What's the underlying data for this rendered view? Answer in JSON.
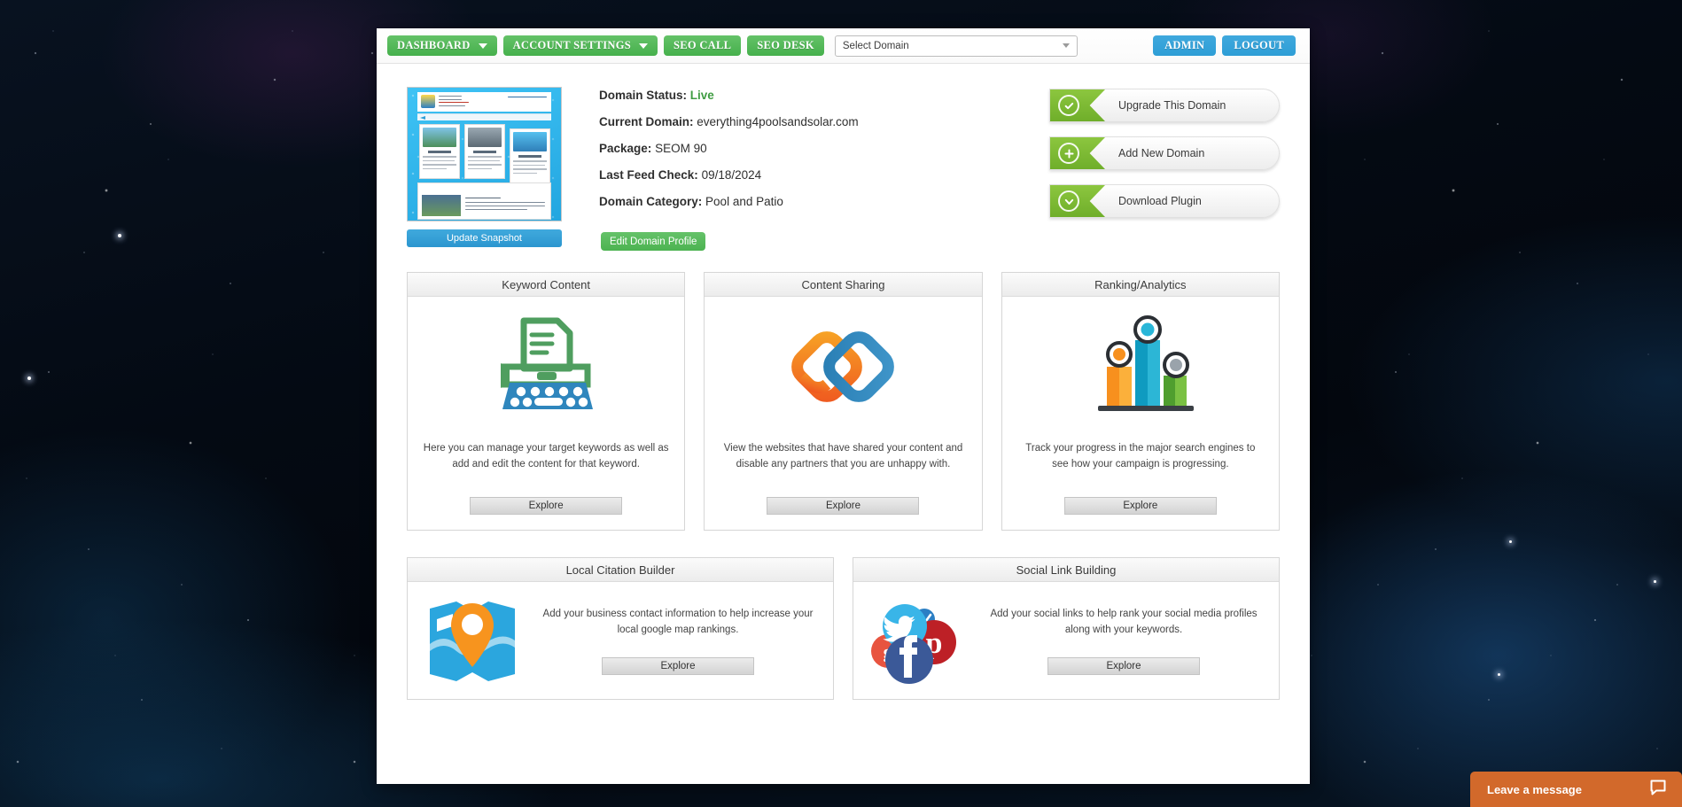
{
  "nav": {
    "buttons": [
      {
        "label": "DASHBOARD",
        "caret": true
      },
      {
        "label": "ACCOUNT SETTINGS",
        "caret": true
      },
      {
        "label": "SEO CALL",
        "caret": false
      },
      {
        "label": "SEO DESK",
        "caret": false
      }
    ],
    "domain_select": {
      "value": "Select Domain",
      "icon": "chevron-down-icon"
    },
    "admin_label": "ADMIN",
    "logout_label": "LOGOUT"
  },
  "summary": {
    "update_snapshot_label": "Update Snapshot",
    "edit_profile_label": "Edit Domain Profile",
    "details": [
      {
        "label": "Domain Status:",
        "value": "Live",
        "highlight": true
      },
      {
        "label": "Current Domain:",
        "value": "everything4poolsandsolar.com",
        "highlight": false
      },
      {
        "label": "Package:",
        "value": "SEOM 90",
        "highlight": false
      },
      {
        "label": "Last Feed Check:",
        "value": "09/18/2024",
        "highlight": false
      },
      {
        "label": "Domain Category:",
        "value": "Pool and Patio",
        "highlight": false
      }
    ]
  },
  "actions": [
    {
      "label": "Upgrade This Domain",
      "icon": "check-circle-icon"
    },
    {
      "label": "Add New Domain",
      "icon": "plus-circle-icon"
    },
    {
      "label": "Download Plugin",
      "icon": "download-circle-icon"
    }
  ],
  "cards_top": [
    {
      "title": "Keyword Content",
      "icon": "typewriter-icon",
      "description": "Here you can manage your target keywords as well as add and edit the content for that keyword.",
      "button": "Explore"
    },
    {
      "title": "Content Sharing",
      "icon": "interlocking-links-icon",
      "description": "View the websites that have shared your content and disable any partners that you are unhappy with.",
      "button": "Explore"
    },
    {
      "title": "Ranking/Analytics",
      "icon": "bar-chart-icon",
      "description": "Track your progress in the major search engines to see how your campaign is progressing.",
      "button": "Explore"
    }
  ],
  "cards_bottom": [
    {
      "title": "Local Citation Builder",
      "icon": "map-pin-icon",
      "description": "Add your business contact information to help increase your local google map rankings.",
      "button": "Explore"
    },
    {
      "title": "Social Link Building",
      "icon": "social-cluster-icon",
      "description": "Add your social links to help rank your social media profiles along with your keywords.",
      "button": "Explore"
    }
  ],
  "chat": {
    "label": "Leave a message",
    "icon": "speech-bubble-icon"
  },
  "colors": {
    "nav_green": "#4cb351",
    "nav_blue": "#2e9ed6",
    "action_green": "#8cc63f",
    "status_live": "#3f9c42",
    "chat_orange": "#d2692b"
  }
}
